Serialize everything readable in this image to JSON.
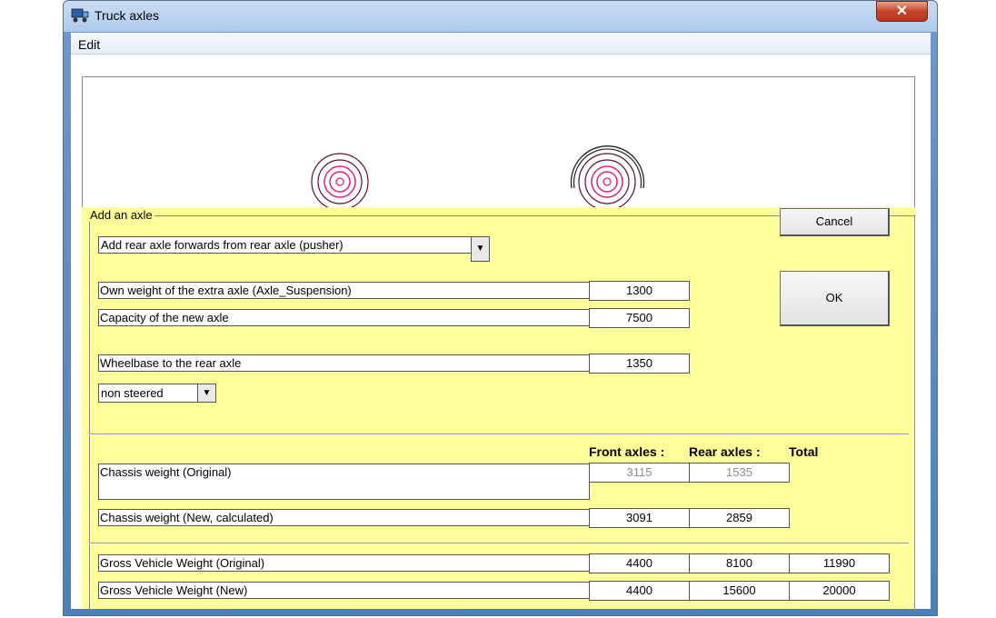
{
  "window": {
    "title": "Truck axles",
    "close_label": "✕"
  },
  "menu": {
    "edit": "Edit"
  },
  "group": {
    "legend": "Add an axle"
  },
  "axle_type": {
    "selected": "Add rear axle forwards from rear axle (pusher)"
  },
  "fields": {
    "own_weight_label": "Own weight of the extra axle (Axle_Suspension)",
    "own_weight_value": "1300",
    "capacity_label": "Capacity of the new axle",
    "capacity_value": "7500",
    "wheelbase_label": "Wheelbase to the rear axle",
    "wheelbase_value": "1350"
  },
  "steering": {
    "selected": "non steered"
  },
  "buttons": {
    "cancel": "Cancel",
    "ok": "OK"
  },
  "table": {
    "headers": {
      "front": "Front axles :",
      "rear": "Rear axles :",
      "total": "Total"
    },
    "chassis_original": {
      "label": "Chassis weight  (Original)",
      "front": "3115",
      "rear": "1535"
    },
    "chassis_new": {
      "label": "Chassis weight  (New, calculated)",
      "front": "3091",
      "rear": "2859"
    },
    "gvw_original": {
      "label": "Gross Vehicle Weight  (Original)",
      "front": "4400",
      "rear": "8100",
      "total": "11990"
    },
    "gvw_new": {
      "label": "Gross Vehicle Weight  (New)",
      "front": "4400",
      "rear": "15600",
      "total": "20000"
    }
  },
  "colors": {
    "panel": "#ffff99",
    "wheel_outer": "#5a1030",
    "wheel_inner": "#e0207a"
  }
}
